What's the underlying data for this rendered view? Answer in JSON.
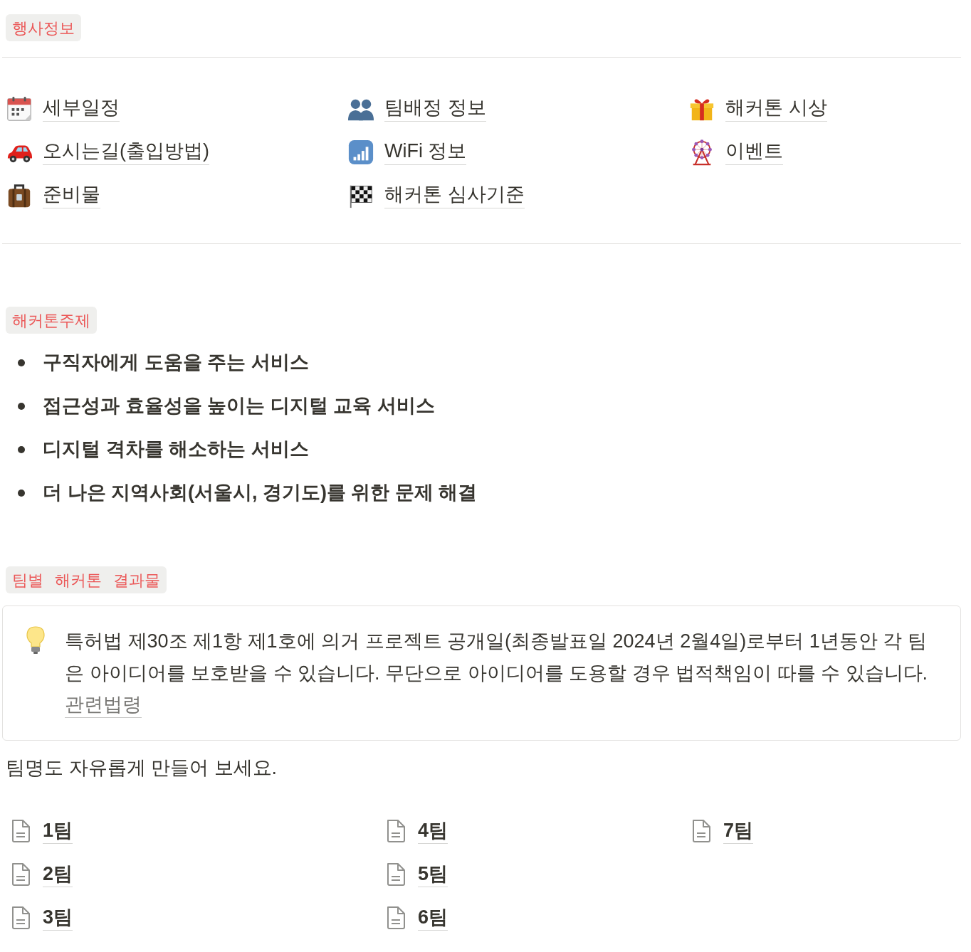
{
  "event_info": {
    "label": "행사정보",
    "columns": [
      {
        "links": [
          "세부일정",
          "오시는길(출입방법)",
          "준비물"
        ]
      },
      {
        "links": [
          "팀배정 정보",
          "WiFi 정보",
          "해커톤 심사기준"
        ]
      },
      {
        "links": [
          "해커톤 시상",
          "이벤트"
        ]
      }
    ]
  },
  "topics": {
    "label": "해커톤주제",
    "items": [
      "구직자에게 도움을 주는 서비스",
      "접근성과 효율성을 높이는 디지털 교육 서비스",
      "디지털 격차를 해소하는 서비스",
      "더 나은 지역사회(서울시, 경기도)를 위한 문제 해결"
    ]
  },
  "team_results": {
    "label": "팀별 해커톤 결과물",
    "callout": {
      "text": "특허법 제30조 제1항 제1호에 의거 프로젝트 공개일(최종발표일 2024년 2월4일)로부터 1년동안 각 팀은 아이디어를 보호받을 수 있습니다. 무단으로 아이디어를 도용할 경우 법적책임이 따를 수 있습니다.",
      "link": "관련법령"
    },
    "note": "팀명도 자유롭게 만들어 보세요.",
    "columns": [
      {
        "pages": [
          "1팀",
          "2팀",
          "3팀"
        ]
      },
      {
        "pages": [
          "4팀",
          "5팀",
          "6팀"
        ]
      },
      {
        "pages": [
          "7팀"
        ]
      }
    ]
  }
}
